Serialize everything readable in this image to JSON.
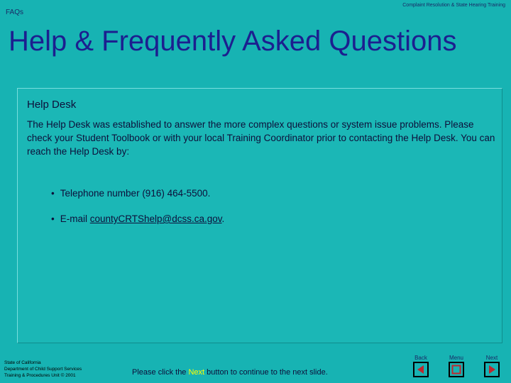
{
  "header": {
    "section_label": "FAQs",
    "course_title": "Complaint Resolution & State Hearing Training"
  },
  "title": "Help & Frequently Asked Questions",
  "content": {
    "heading": "Help Desk",
    "paragraph": "The Help Desk was established to answer the more complex questions or system issue problems.  Please check your Student Toolbook or with your local Training Coordinator prior to contacting the Help Desk.  You can reach the Help Desk by:",
    "contacts": {
      "phone": "Telephone number (916) 464-5500.",
      "email_prefix": "E-mail ",
      "email_address": "countyCRTShelp@dcss.ca.gov",
      "email_suffix": "."
    }
  },
  "footer": {
    "org_line1": "State of California",
    "org_line2": "Department of Child Support Services",
    "org_line3": "Training & Procedures Unit  © 2001",
    "instruction_before": "Please click the ",
    "instruction_highlight": "Next",
    "instruction_after": " button to continue to the next slide."
  },
  "nav": {
    "back_label": "Back",
    "menu_label": "Menu",
    "next_label": "Next"
  },
  "colors": {
    "background": "#17B3B3",
    "title": "#1C1F8F",
    "highlight": "#FFFF00",
    "nav_icon": "#C0272D"
  },
  "icons": {
    "back": "back-arrow-icon",
    "menu": "menu-square-icon",
    "next": "next-arrow-icon"
  }
}
